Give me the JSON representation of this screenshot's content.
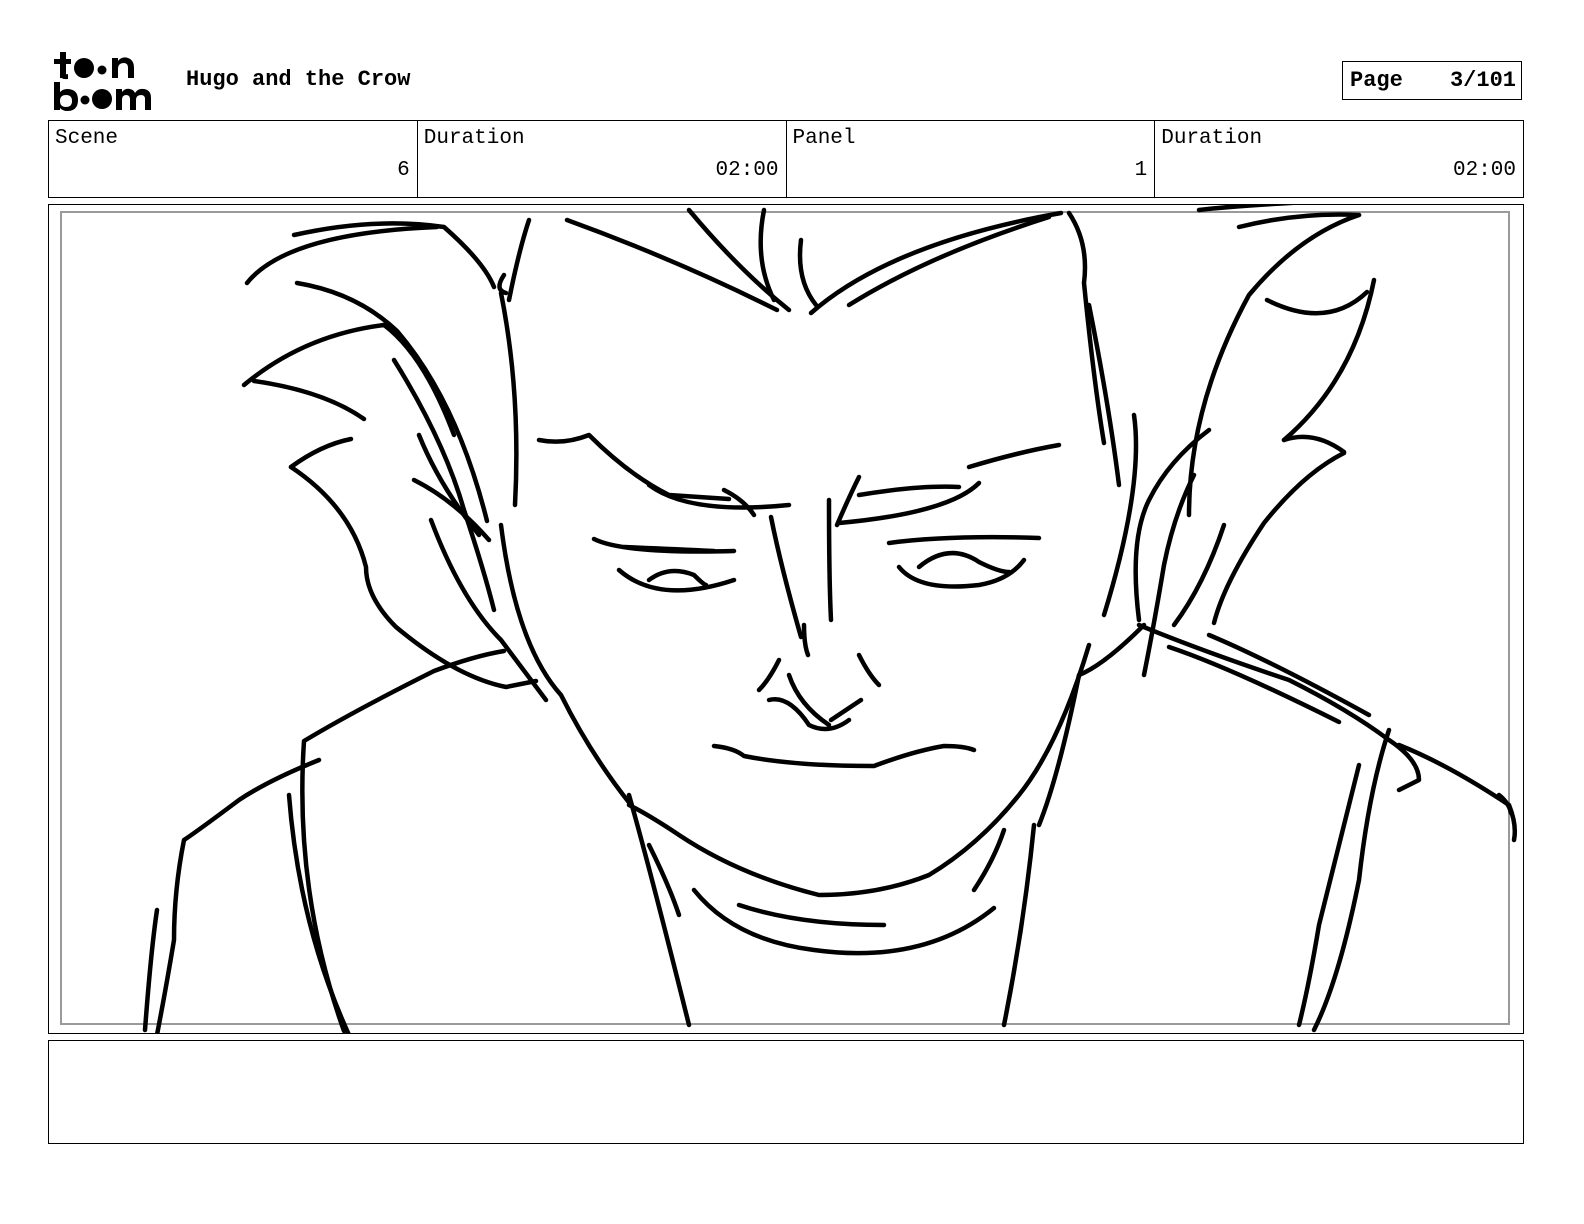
{
  "header": {
    "logo_text": "toonboom",
    "project_title": "Hugo and the Crow",
    "page_label": "Page",
    "page_number": "3/101"
  },
  "info": {
    "scene_label": "Scene",
    "scene_value": "6",
    "scene_duration_label": "Duration",
    "scene_duration_value": "02:00",
    "panel_label": "Panel",
    "panel_value": "1",
    "panel_duration_label": "Duration",
    "panel_duration_value": "02:00"
  },
  "notes": {
    "text": ""
  }
}
